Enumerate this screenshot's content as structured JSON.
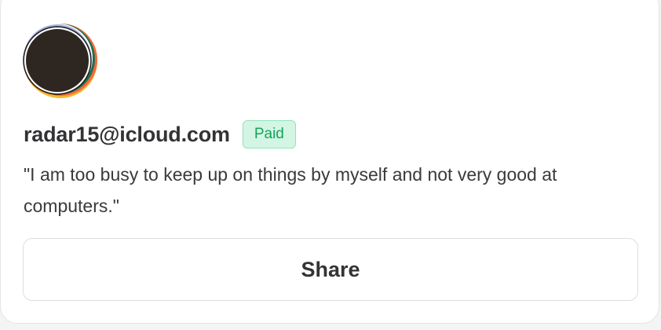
{
  "profile": {
    "avatar_icon": "user-avatar-logo",
    "email": "radar15@icloud.com",
    "status_badge": "Paid",
    "quote": "\"I am too busy to keep up on things by myself and not very good at computers.\""
  },
  "actions": {
    "share_label": "Share"
  },
  "colors": {
    "badge_bg": "#d3f6e4",
    "badge_text": "#16a25a",
    "text_primary": "#333336"
  }
}
